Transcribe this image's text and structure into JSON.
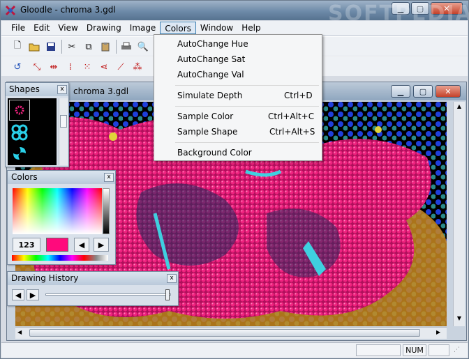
{
  "window": {
    "title": "Gloodle - chroma 3.gdl"
  },
  "menubar": {
    "items": [
      "File",
      "Edit",
      "View",
      "Drawing",
      "Image",
      "Colors",
      "Window",
      "Help"
    ]
  },
  "child_window": {
    "title": "chroma 3.gdl"
  },
  "colors_menu": {
    "autochange_hue": "AutoChange Hue",
    "autochange_sat": "AutoChange Sat",
    "autochange_val": "AutoChange Val",
    "simulate_depth": "Simulate Depth",
    "simulate_depth_shortcut": "Ctrl+D",
    "sample_color": "Sample Color",
    "sample_color_shortcut": "Ctrl+Alt+C",
    "sample_shape": "Sample Shape",
    "sample_shape_shortcut": "Ctrl+Alt+S",
    "background_color": "Background Color"
  },
  "shapes_panel": {
    "title": "Shapes",
    "close": "x"
  },
  "colors_panel": {
    "title": "Colors",
    "close": "x",
    "rgb_button": "123",
    "current_color": "#ff0a7c"
  },
  "history_panel": {
    "title": "Drawing History",
    "close": "x"
  },
  "statusbar": {
    "num": "NUM"
  },
  "watermark": "SOFTPEDIA"
}
